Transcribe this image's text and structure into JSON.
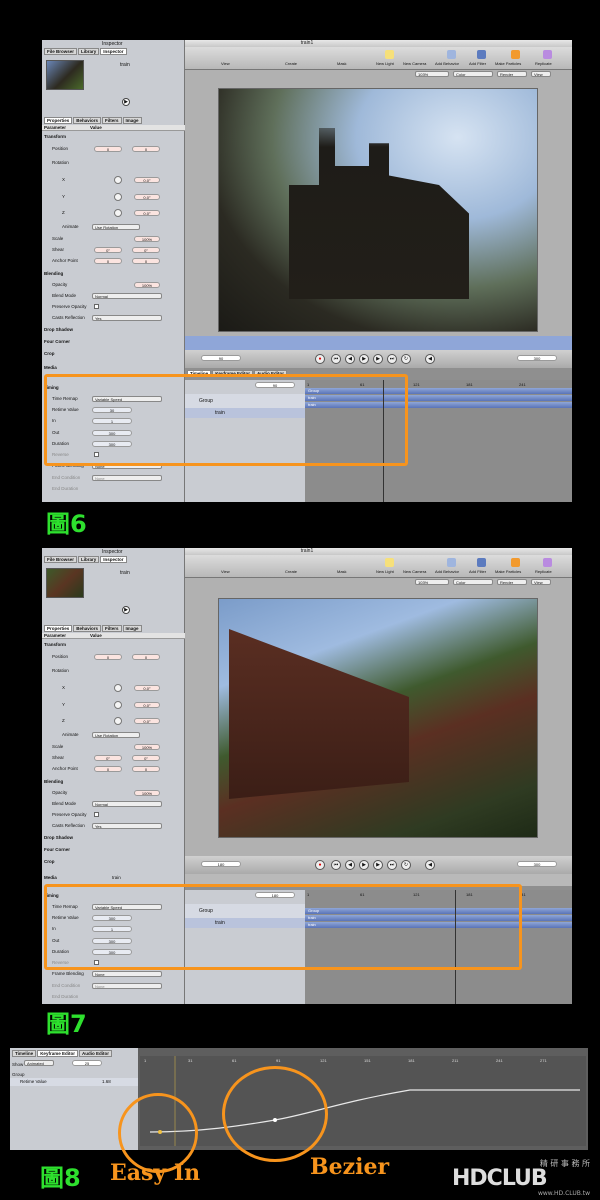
{
  "window_title": "train1",
  "inspector": {
    "title": "Inspector",
    "tabs_top": [
      "File Browser",
      "Library",
      "Inspector"
    ],
    "clip_name": "train",
    "tabs": [
      "Properties",
      "Behaviors",
      "Filters",
      "Image"
    ],
    "col_parameter": "Parameter",
    "col_value": "Value",
    "sections": {
      "transform": "Transform",
      "position": "Position",
      "rotation": "Rotation",
      "x": "X",
      "y": "Y",
      "z": "Z",
      "animate": "Animate",
      "animate_value": "Use Rotation",
      "scale": "Scale",
      "shear": "Shear",
      "anchor": "Anchor Point",
      "blending": "Blending",
      "opacity": "Opacity",
      "blend_mode": "Blend Mode",
      "blend_mode_value": "Normal",
      "preserve_opacity": "Preserve Opacity",
      "casts_reflection": "Casts Reflection",
      "casts_reflection_value": "Yes",
      "drop_shadow": "Drop Shadow",
      "four_corner": "Four Corner",
      "crop": "Crop",
      "media": "Media",
      "timing": "Timing",
      "time_remap": "Time Remap",
      "time_remap_value": "Variable Speed",
      "retime_value": "Retime Value",
      "in": "In",
      "out": "Out",
      "duration": "Duration",
      "reverse": "Reverse",
      "frame_blending": "Frame Blending",
      "frame_blending_value": "None",
      "end_condition": "End Condition",
      "end_condition_value": "None",
      "end_duration": "End Duration"
    },
    "values": {
      "zero": "0",
      "deg": "0.0°",
      "pct": "100%",
      "shear": "0°",
      "one": "1",
      "three_hundred": "300",
      "fig6_retime": "30",
      "fig7_retime": "300"
    }
  },
  "toolbar": {
    "view": "View",
    "create": "Create",
    "mask": "Mask",
    "new_light": "New Light",
    "new_camera": "New Camera",
    "add_behavior": "Add Behavior",
    "add_filter": "Add Filter",
    "make_particles": "Make Particles",
    "replicate": "Replicate",
    "zoom": "103%",
    "color": "Color",
    "render": "Render",
    "view_menu": "View"
  },
  "transport": {
    "fig6_frame": "90",
    "fig7_frame": "180",
    "end_frame": "300"
  },
  "timeline": {
    "tabs": [
      "Timeline",
      "Keyframe Editor",
      "Audio Editor"
    ],
    "group": "Group",
    "layer": "train",
    "ruler": [
      "1",
      "61",
      "121",
      "181",
      "241"
    ]
  },
  "keyframe_panel": {
    "tabs": [
      "Timeline",
      "Keyframe Editor",
      "Audio Editor"
    ],
    "show": "Show",
    "show_value": "Animated",
    "param": "Retime Value",
    "param_val": "1.68",
    "frame": "25",
    "ruler": [
      "1",
      "31",
      "61",
      "91",
      "121",
      "151",
      "181",
      "211",
      "241",
      "271"
    ]
  },
  "figures": {
    "fig6": "圖6",
    "fig7": "圖7",
    "fig8": "圖8",
    "easy_in": "Easy In",
    "bezier": "Bezier"
  },
  "logo": {
    "text": "HDCLUB",
    "sub": "精 研 事 務 所",
    "url": "www.HD.CLUB.tw"
  },
  "colors": {
    "accent": "#f7941d",
    "figure": "#2ee02e",
    "timeline_bar": "#5a74b8"
  }
}
